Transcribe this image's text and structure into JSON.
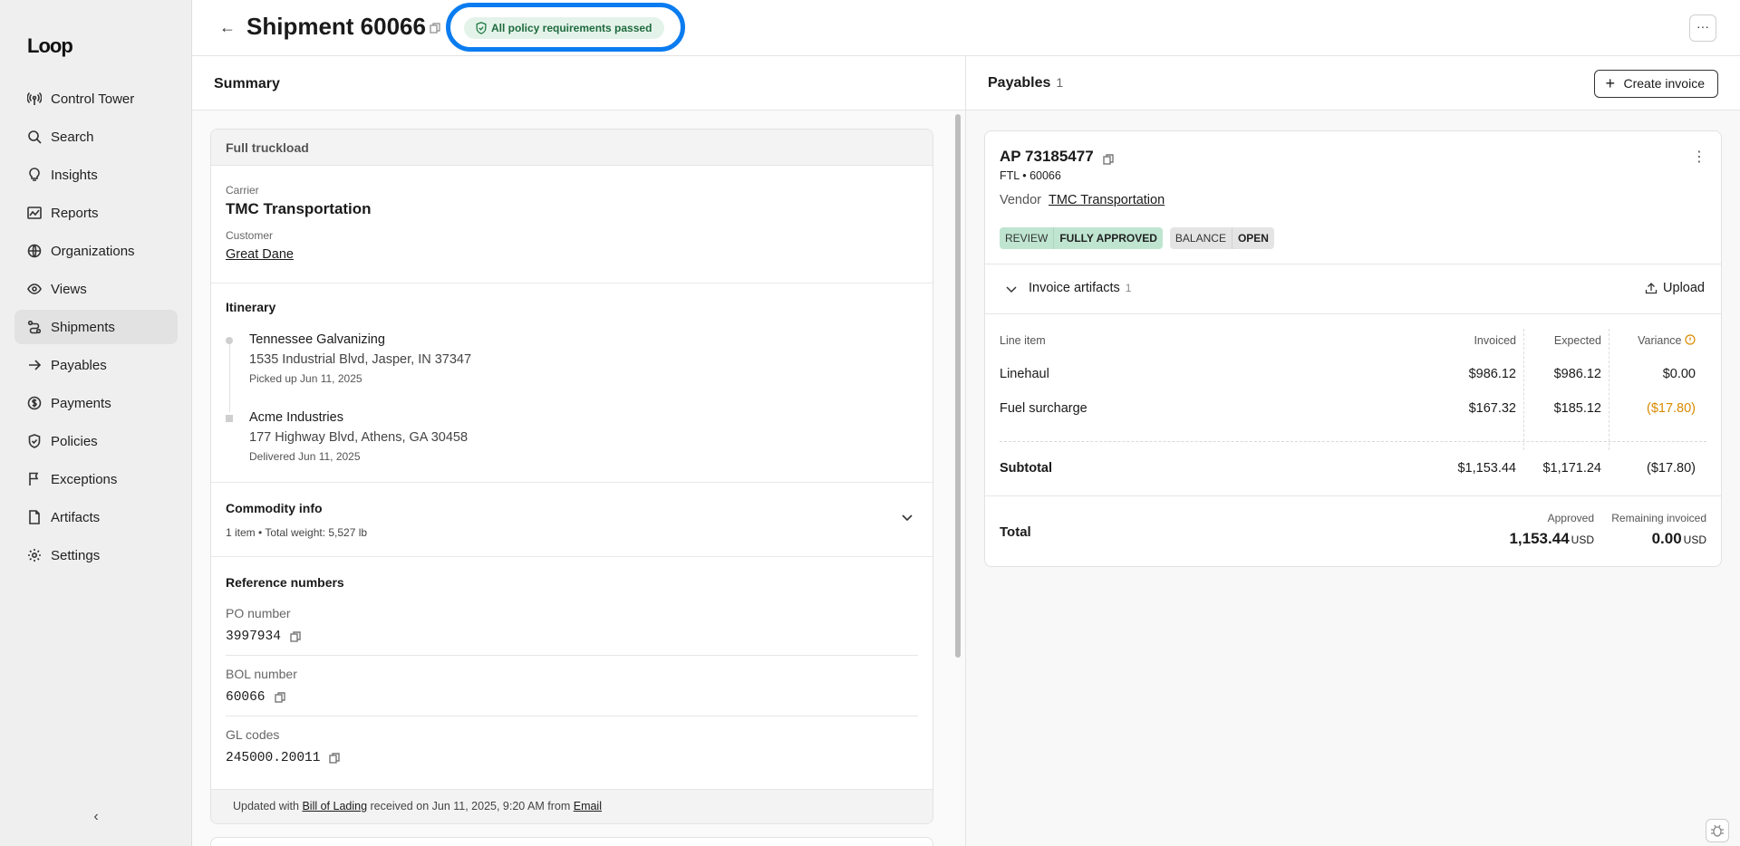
{
  "app": {
    "logo": "Loop"
  },
  "sidebar": {
    "items": [
      {
        "label": "Control Tower",
        "icon": "broadcast-icon"
      },
      {
        "label": "Search",
        "icon": "search-icon"
      },
      {
        "label": "Insights",
        "icon": "lightbulb-icon"
      },
      {
        "label": "Reports",
        "icon": "chart-icon"
      },
      {
        "label": "Organizations",
        "icon": "globe-icon"
      },
      {
        "label": "Views",
        "icon": "eye-icon"
      },
      {
        "label": "Shipments",
        "icon": "route-icon",
        "active": true
      },
      {
        "label": "Payables",
        "icon": "arrow-right-icon"
      },
      {
        "label": "Payments",
        "icon": "dollar-icon"
      },
      {
        "label": "Policies",
        "icon": "shield-check-icon"
      },
      {
        "label": "Exceptions",
        "icon": "flag-icon"
      },
      {
        "label": "Artifacts",
        "icon": "file-icon"
      },
      {
        "label": "Settings",
        "icon": "gear-icon"
      }
    ],
    "collapse_glyph": "‹"
  },
  "header": {
    "title": "Shipment 60066",
    "policy_badge": "All policy requirements passed",
    "more_label": "···",
    "back_glyph": "←"
  },
  "summary": {
    "title": "Summary",
    "card_title": "Full truckload",
    "carrier_label": "Carrier",
    "carrier_name": "TMC Transportation",
    "customer_label": "Customer",
    "customer_name": "Great Dane",
    "itinerary_title": "Itinerary",
    "stops": [
      {
        "name": "Tennessee Galvanizing",
        "address": "1535 Industrial Blvd, Jasper, IN 37347",
        "status": "Picked up Jun 11, 2025"
      },
      {
        "name": "Acme Industries",
        "address": "177 Highway Blvd, Athens, GA 30458",
        "status": "Delivered Jun 11, 2025"
      }
    ],
    "commodity_title": "Commodity info",
    "commodity_sub": "1 item • Total weight: 5,527 lb",
    "ref_title": "Reference numbers",
    "refs": [
      {
        "label": "PO number",
        "value": "3997934"
      },
      {
        "label": "BOL number",
        "value": "60066"
      },
      {
        "label": "GL codes",
        "value": "245000.20011"
      }
    ],
    "footer": {
      "prefix": "Updated with",
      "doc_link": "Bill of Lading",
      "middle": "received on Jun 11, 2025, 9:20 AM from",
      "source_link": "Email"
    }
  },
  "payables": {
    "title": "Payables",
    "count": "1",
    "create_label": "Create invoice",
    "ap": {
      "title": "AP 73185477",
      "sub": "FTL • 60066",
      "vendor_label": "Vendor",
      "vendor_name": "TMC Transportation",
      "review_key": "REVIEW",
      "review_val": "FULLY APPROVED",
      "balance_key": "BALANCE",
      "balance_val": "OPEN",
      "artifacts_label": "Invoice artifacts",
      "artifacts_count": "1",
      "upload_label": "Upload",
      "columns": [
        "Line item",
        "Invoiced",
        "Expected",
        "Variance"
      ],
      "rows": [
        {
          "item": "Linehaul",
          "invoiced": "$986.12",
          "expected": "$986.12",
          "variance": "$0.00"
        },
        {
          "item": "Fuel surcharge",
          "invoiced": "$167.32",
          "expected": "$185.12",
          "variance": "($17.80)"
        }
      ],
      "subtotal": {
        "label": "Subtotal",
        "invoiced": "$1,153.44",
        "expected": "$1,171.24",
        "variance": "($17.80)"
      },
      "total": {
        "label": "Total",
        "approved_label": "Approved",
        "approved_value": "1,153.44",
        "remaining_label": "Remaining invoiced",
        "remaining_value": "0.00",
        "currency": "USD"
      }
    }
  },
  "colors": {
    "accent_ring": "#0a7cf0",
    "badge_green": "#e4f3ea",
    "variance_negative": "#d98a00"
  }
}
